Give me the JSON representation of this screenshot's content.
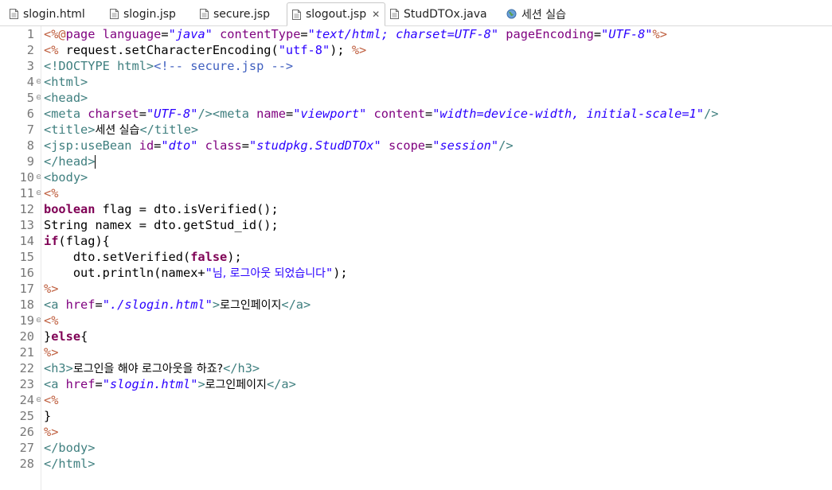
{
  "tabs": [
    {
      "label": "slogin.html",
      "icon": "file-icon",
      "active": false
    },
    {
      "label": "slogin.jsp",
      "icon": "file-icon",
      "active": false
    },
    {
      "label": "secure.jsp",
      "icon": "file-icon",
      "active": false
    },
    {
      "label": "slogout.jsp",
      "icon": "file-icon",
      "active": true,
      "close": "✕"
    },
    {
      "label": "StudDTOx.java",
      "icon": "java-file-icon",
      "active": false
    },
    {
      "label": "세션 실습",
      "icon": "globe-icon",
      "active": false
    }
  ],
  "line_numbers": [
    "1",
    "2",
    "3",
    "4",
    "5",
    "6",
    "7",
    "8",
    "9",
    "10",
    "11",
    "12",
    "13",
    "14",
    "15",
    "16",
    "17",
    "18",
    "19",
    "20",
    "21",
    "22",
    "23",
    "24",
    "25",
    "26",
    "27",
    "28"
  ],
  "fold_markers": [
    "⊖",
    "⊖",
    "⊖",
    "⊖",
    "⊖"
  ],
  "code": {
    "l1": [
      "<%@",
      "page",
      " ",
      "language",
      "=",
      "\"java\"",
      " ",
      "contentType",
      "=",
      "\"text/html; charset=UTF-8\"",
      " ",
      "pageEncoding",
      "=",
      "\"UTF-8\"",
      "%>"
    ],
    "l2": [
      "<%",
      " request.setCharacterEncoding(",
      "\"utf-8\"",
      "); ",
      "%>"
    ],
    "l3": [
      "<!DOCTYPE html>",
      "<!-- secure.jsp -->"
    ],
    "l4": [
      "<html>"
    ],
    "l5": [
      "<head>"
    ],
    "l6": [
      "<meta",
      " ",
      "charset",
      "=",
      "\"UTF-8\"",
      "/>",
      "<meta",
      " ",
      "name",
      "=",
      "\"viewport\"",
      " ",
      "content",
      "=",
      "\"width=device-width, initial-scale=1\"",
      "/>"
    ],
    "l7": [
      "<title>",
      "세션 실습",
      "</title>"
    ],
    "l8": [
      "<jsp:useBean",
      " ",
      "id",
      "=",
      "\"dto\"",
      " ",
      "class",
      "=",
      "\"studpkg.StudDTOx\"",
      " ",
      "scope",
      "=",
      "\"session\"",
      "/>"
    ],
    "l9": [
      "</head>"
    ],
    "l10": [
      "<body>"
    ],
    "l11": [
      "<%"
    ],
    "l12": [
      "boolean",
      " flag = dto.isVerified();"
    ],
    "l13": [
      "String namex = dto.getStud_id();"
    ],
    "l14": [
      "if",
      "(flag){"
    ],
    "l15": [
      "    dto.setVerified(",
      "false",
      ");"
    ],
    "l16": [
      "    out.println(namex+",
      "\"",
      "님, 로그아웃 되었습니다",
      "\"",
      ");"
    ],
    "l17": [
      "%>"
    ],
    "l18": [
      "<a",
      " ",
      "href",
      "=",
      "\"./slogin.html\"",
      ">",
      "로그인페이지",
      "</a>"
    ],
    "l19": [
      "<%"
    ],
    "l20": [
      "}",
      "else",
      "{"
    ],
    "l21": [
      "%>"
    ],
    "l22": [
      "<h3>",
      "로그인을 해야 로그아웃을 하죠?",
      "</h3>"
    ],
    "l23": [
      "<a",
      " ",
      "href",
      "=",
      "\"slogin.html\"",
      ">",
      "로그인페이지",
      "</a>"
    ],
    "l24": [
      "<%"
    ],
    "l25": [
      "}"
    ],
    "l26": [
      "%>"
    ],
    "l27": [
      "</body>"
    ],
    "l28": [
      "</html>"
    ]
  },
  "colors": {
    "tag": "#3f7f7f",
    "attribute": "#7f007f",
    "string": "#2a00ff",
    "keyword": "#7f0055",
    "delimiter": "#bf5f3f",
    "comment": "#3f5fbf",
    "line_number": "#787878"
  }
}
